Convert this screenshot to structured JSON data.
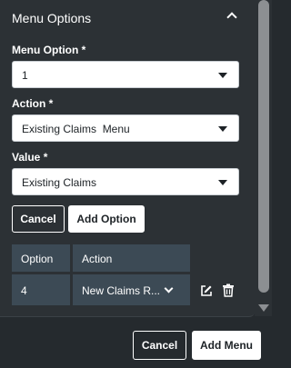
{
  "section": {
    "title": "Menu Options"
  },
  "form": {
    "menu_option": {
      "label": "Menu Option *",
      "value": "1"
    },
    "action": {
      "label": "Action *",
      "value": "Existing Claims  Menu"
    },
    "value": {
      "label": "Value *",
      "value": "Existing Claims"
    },
    "cancel_label": "Cancel",
    "add_option_label": "Add Option"
  },
  "table": {
    "headers": [
      "Option",
      "Action"
    ],
    "rows": [
      {
        "option": "4",
        "action": "New Claims R..."
      }
    ]
  },
  "footer": {
    "cancel_label": "Cancel",
    "add_menu_label": "Add Menu"
  },
  "icons": {
    "collapse": "chevron-up-icon",
    "dropdown": "caret-down-icon",
    "row_dropdown": "chevron-down-icon",
    "edit": "edit-icon",
    "delete": "trash-icon",
    "scroll_down": "scroll-down-icon"
  },
  "colors": {
    "panel_background": "#2c3135",
    "page_background": "#252a2e",
    "table_cell": "#3c4a55",
    "text": "#ffffff"
  }
}
